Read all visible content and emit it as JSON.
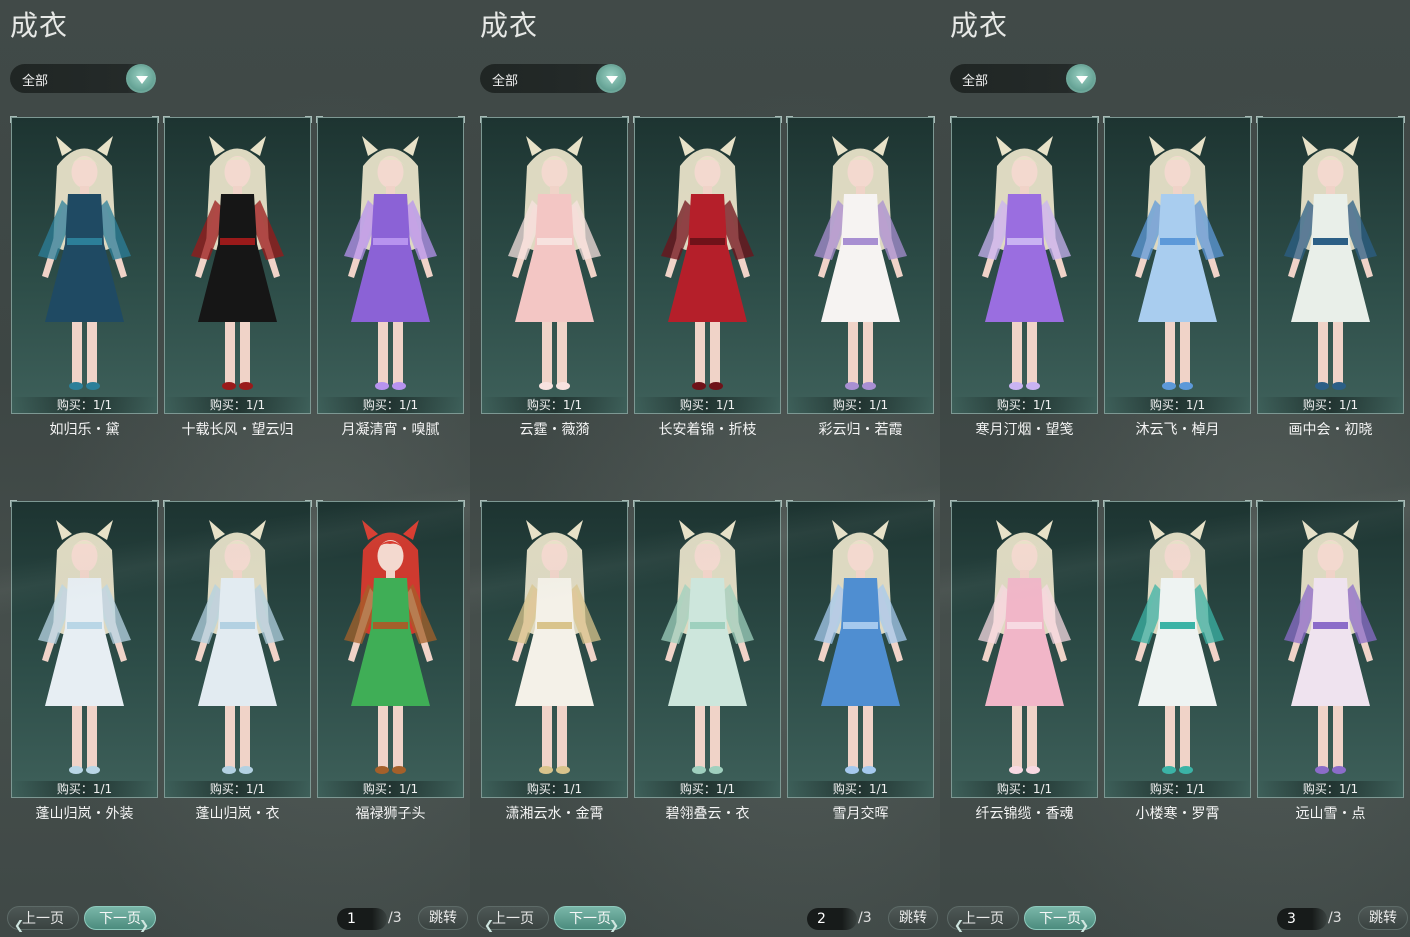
{
  "panels": [
    {
      "title": "成衣",
      "filter": "全部",
      "items": [
        {
          "name": "如归乐・黛",
          "purchase": "购买：1/1",
          "dress": "#1f4a63",
          "accent": "#2c7f99",
          "hair": "#e8e2c8"
        },
        {
          "name": "十载长风・望云归",
          "purchase": "购买：1/1",
          "dress": "#161616",
          "accent": "#9a1a1a",
          "hair": "#e8e2c8"
        },
        {
          "name": "月凝清宵・嗅腻",
          "purchase": "购买：1/1",
          "dress": "#8b62d6",
          "accent": "#b793ef",
          "hair": "#e8e2c8"
        },
        {
          "name": "蓬山归岚・外装",
          "purchase": "购买：1/1",
          "dress": "#e7eef3",
          "accent": "#b9d6e6",
          "hair": "#e8e2c8"
        },
        {
          "name": "蓬山归岚・衣",
          "purchase": "购买：1/1",
          "dress": "#e2ebf1",
          "accent": "#b3d1e2",
          "hair": "#e8e2c8"
        },
        {
          "name": "福禄狮子头",
          "purchase": "购买：1/1",
          "dress": "#3fae56",
          "accent": "#a4602a",
          "hair": "#d83a2e"
        }
      ],
      "prev": "上一页",
      "next": "下一页",
      "page": "1",
      "total": "/3",
      "jump": "跳转"
    },
    {
      "title": "成衣",
      "filter": "全部",
      "items": [
        {
          "name": "云霆・薇漪",
          "purchase": "购买：1/1",
          "dress": "#f3c6c4",
          "accent": "#f7e2df",
          "hair": "#e8e2c8"
        },
        {
          "name": "长安着锦・折枝",
          "purchase": "购买：1/1",
          "dress": "#b51f2a",
          "accent": "#6f1219",
          "hair": "#e8e2c8"
        },
        {
          "name": "彩云归・若霞",
          "purchase": "购买：1/1",
          "dress": "#f6f3f2",
          "accent": "#a88fd2",
          "hair": "#e8e2c8"
        },
        {
          "name": "潇湘云水・金霄",
          "purchase": "购买：1/1",
          "dress": "#f4f1e8",
          "accent": "#d9c48c",
          "hair": "#e8e2c8"
        },
        {
          "name": "碧翎叠云・衣",
          "purchase": "购买：1/1",
          "dress": "#cde6dc",
          "accent": "#9fd0be",
          "hair": "#e8e2c8"
        },
        {
          "name": "雪月交晖",
          "purchase": "购买：1/1",
          "dress": "#4f8ed1",
          "accent": "#a5c9ee",
          "hair": "#e8e2c8"
        }
      ],
      "prev": "上一页",
      "next": "下一页",
      "page": "2",
      "total": "/3",
      "jump": "跳转"
    },
    {
      "title": "成衣",
      "filter": "全部",
      "items": [
        {
          "name": "寒月汀烟・望笺",
          "purchase": "购买：1/1",
          "dress": "#9a6ee0",
          "accent": "#c9b3f2",
          "hair": "#e8e2c8"
        },
        {
          "name": "沐云飞・棹月",
          "purchase": "购买：1/1",
          "dress": "#a9cdef",
          "accent": "#5d99d9",
          "hair": "#e8e2c8"
        },
        {
          "name": "画中会・初晓",
          "purchase": "购买：1/1",
          "dress": "#e9efe9",
          "accent": "#2c5f86",
          "hair": "#e8e2c8"
        },
        {
          "name": "纤云锦缆・香魂",
          "purchase": "购买：1/1",
          "dress": "#f1b6c8",
          "accent": "#f7d9e2",
          "hair": "#e8e2c8"
        },
        {
          "name": "小楼寒・罗霄",
          "purchase": "购买：1/1",
          "dress": "#eef3f2",
          "accent": "#3bb3a6",
          "hair": "#e8e2c8"
        },
        {
          "name": "远山雪・点",
          "purchase": "购买：1/1",
          "dress": "#efe3ef",
          "accent": "#8b6cc9",
          "hair": "#e8e2c8"
        }
      ],
      "prev": "上一页",
      "next": "下一页",
      "page": "3",
      "total": "/3",
      "jump": "跳转"
    }
  ]
}
